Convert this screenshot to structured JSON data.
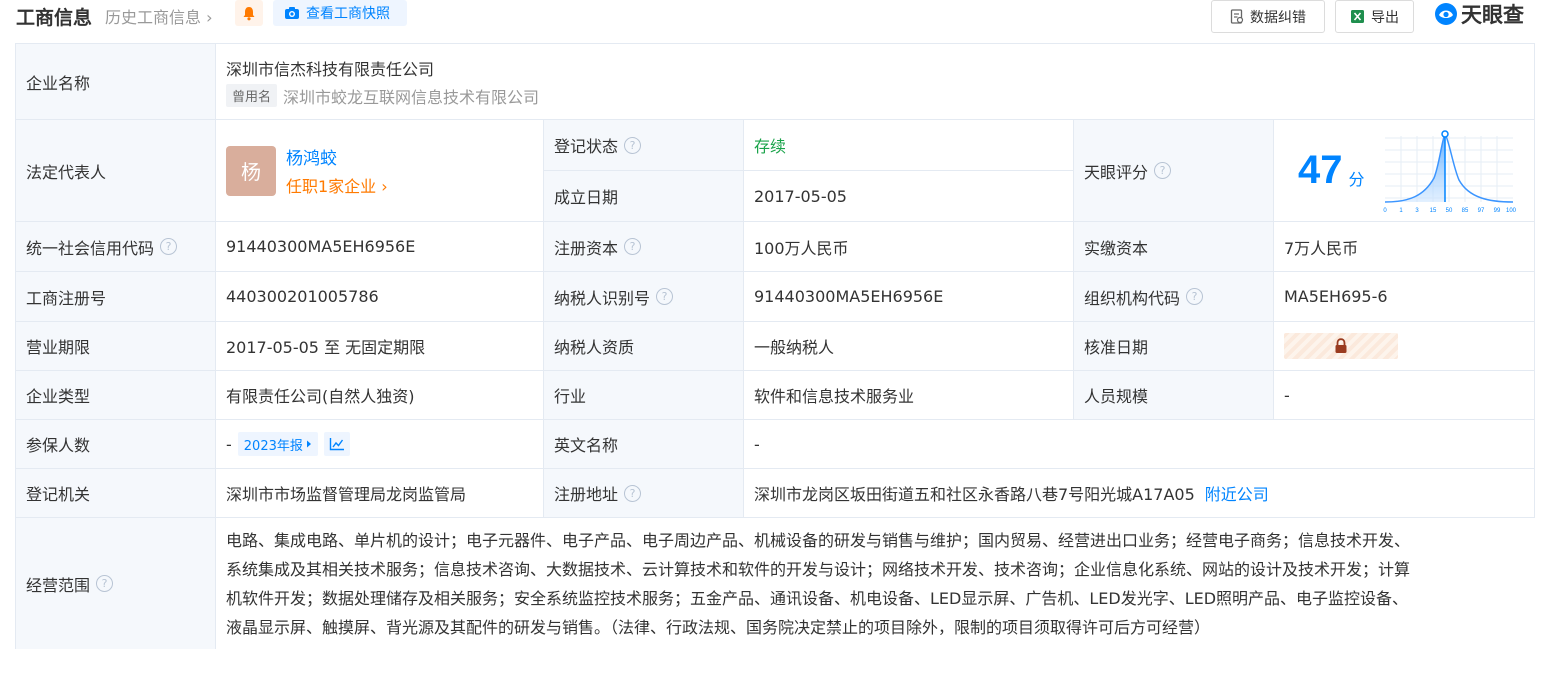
{
  "header": {
    "title": "工商信息",
    "history_link": "历史工商信息",
    "snapshot_button": "查看工商快照",
    "error_button": "数据纠错",
    "export_button": "导出",
    "brand": "天眼查"
  },
  "company": {
    "name_label": "企业名称",
    "name": "深圳市信杰科技有限责任公司",
    "former_tag": "曾用名",
    "former_name": "深圳市蛟龙互联网信息技术有限公司"
  },
  "legal_rep": {
    "label": "法定代表人",
    "avatar_char": "杨",
    "name": "杨鸿蛟",
    "position_link": "任职1家企业"
  },
  "reg_status": {
    "label": "登记状态",
    "value": "存续"
  },
  "established": {
    "label": "成立日期",
    "value": "2017-05-05"
  },
  "score": {
    "label": "天眼评分",
    "value": "47",
    "unit": "分",
    "ticks": [
      "0",
      "1",
      "3",
      "15",
      "50",
      "85",
      "97",
      "99",
      "100"
    ]
  },
  "rows": {
    "credit_code": {
      "label": "统一社会信用代码",
      "value": "91440300MA5EH6956E"
    },
    "reg_capital": {
      "label": "注册资本",
      "value": "100万人民币"
    },
    "paid_capital": {
      "label": "实缴资本",
      "value": "7万人民币"
    },
    "reg_number": {
      "label": "工商注册号",
      "value": "440300201005786"
    },
    "taxpayer_id": {
      "label": "纳税人识别号",
      "value": "91440300MA5EH6956E"
    },
    "org_code": {
      "label": "组织机构代码",
      "value": "MA5EH695-6"
    },
    "term": {
      "label": "营业期限",
      "value": "2017-05-05 至 无固定期限"
    },
    "taxpayer_type": {
      "label": "纳税人资质",
      "value": "一般纳税人"
    },
    "approval_date": {
      "label": "核准日期"
    },
    "company_type": {
      "label": "企业类型",
      "value": "有限责任公司(自然人独资)"
    },
    "industry": {
      "label": "行业",
      "value": "软件和信息技术服务业"
    },
    "staff_size": {
      "label": "人员规模",
      "value": "-"
    },
    "insured": {
      "label": "参保人数",
      "value": "-",
      "report_tag": "2023年报"
    },
    "english_name": {
      "label": "英文名称",
      "value": "-"
    },
    "authority": {
      "label": "登记机关",
      "value": "深圳市市场监督管理局龙岗监管局"
    },
    "address": {
      "label": "注册地址",
      "value": "深圳市龙岗区坂田街道五和社区永香路八巷7号阳光城A17A05",
      "nearby_link": "附近公司"
    },
    "scope": {
      "label": "经营范围",
      "lines": [
        "电路、集成电路、单片机的设计；电子元器件、电子产品、电子周边产品、机械设备的研发与销售与维护；国内贸易、经营进出口业务；经营电子商务；信息技术开发、",
        "系统集成及其相关技术服务；信息技术咨询、大数据技术、云计算技术和软件的开发与设计；网络技术开发、技术咨询；企业信息化系统、网站的设计及技术开发；计算",
        "机软件开发；数据处理储存及相关服务；安全系统监控技术服务；五金产品、通讯设备、机电设备、LED显示屏、广告机、LED发光字、LED照明产品、电子监控设备、",
        "液晶显示屏、触摸屏、背光源及其配件的研发与销售。（法律、行政法规、国务院决定禁止的项目除外，限制的项目须取得许可后方可经营）"
      ]
    }
  },
  "colors": {
    "accent": "#0084ff",
    "orange": "#ff7a00",
    "green": "#1aa34a",
    "label_bg": "#f5f8fc",
    "border": "#e4eaf2"
  }
}
